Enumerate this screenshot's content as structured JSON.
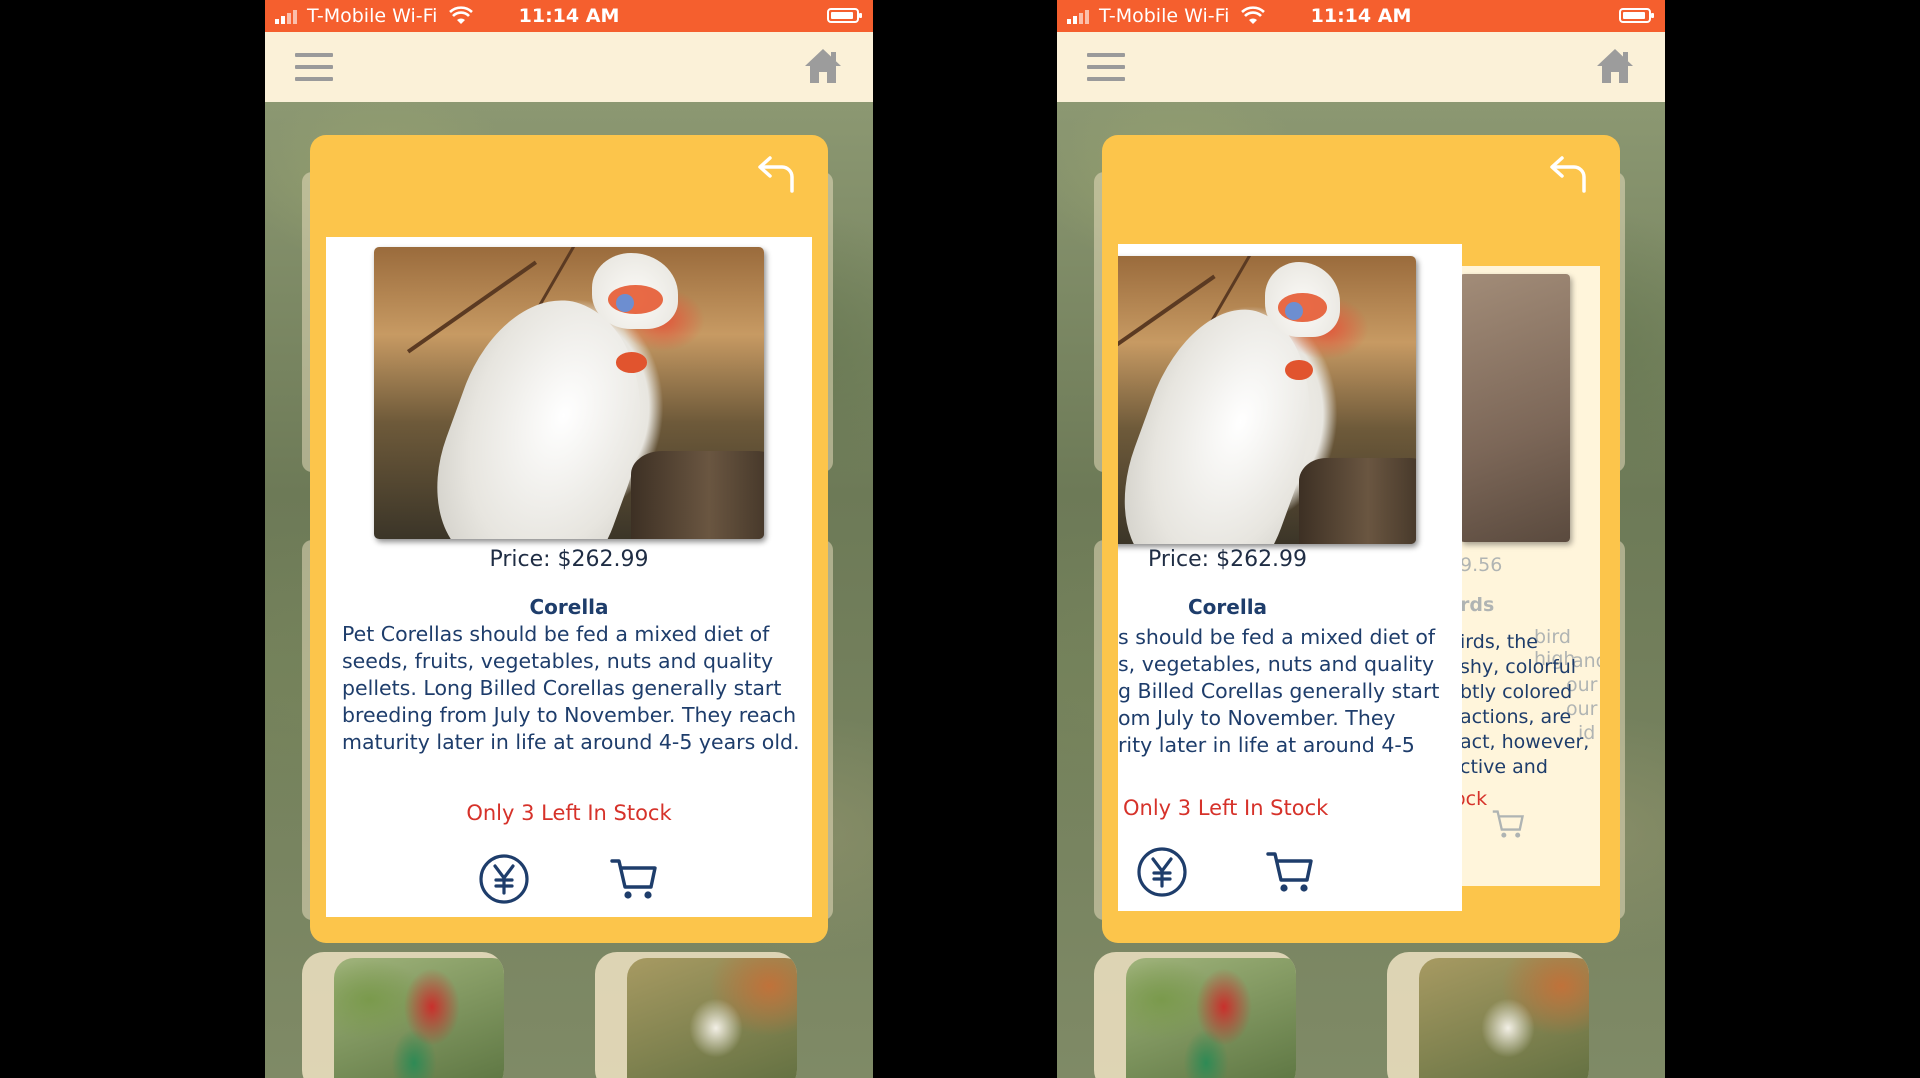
{
  "status_bar": {
    "carrier": "T-Mobile Wi-Fi",
    "time": "11:14 AM"
  },
  "icons": {
    "menu": "hamburger-menu-icon",
    "home": "home-icon",
    "back": "back-arrow-icon",
    "currency": "yen-currency-icon",
    "cart": "shopping-cart-icon"
  },
  "colors": {
    "status_bar": "#f55f2e",
    "app_bar": "#fbf1d8",
    "modal": "#fcc54b",
    "text": "#1e3d6b",
    "stock": "#d6322a"
  },
  "product": {
    "price_label": "Price: $262.99",
    "name": "Corella",
    "description": "Pet Corellas should be fed a mixed diet of seeds, fruits, vegetables, nuts and quality pellets. Long Billed Corellas generally start breeding from July to November. They reach maturity later in life at around 4-5 years old.",
    "stock": "Only 3 Left In Stock"
  },
  "right_screen": {
    "front_card": {
      "price_label": "Price: $262.99",
      "name": "Corella",
      "desc_lines": [
        "s should be fed a mixed diet of",
        "s, vegetables, nuts and quality",
        "g Billed Corellas generally start",
        "om July to November. They",
        "rity later in life at around 4-5"
      ],
      "stock": "Only 3 Left In Stock"
    },
    "back_card": {
      "price_fragment": "9.56",
      "name_fragment": "rds",
      "desc_lines": [
        "irds, the",
        "shy, colorful",
        "btly colored",
        "actions, are",
        "act, however,",
        "ctive and"
      ],
      "faded_lines": [
        "bird high",
        "and",
        "our",
        "our",
        "id"
      ],
      "stock_fragment": "ock"
    }
  }
}
